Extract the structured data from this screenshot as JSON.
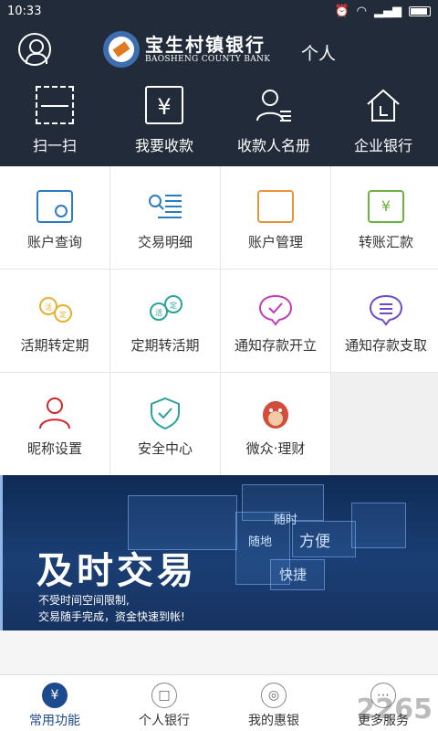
{
  "status": {
    "time": "10:33"
  },
  "header": {
    "bank_name_cn": "宝生村镇银行",
    "bank_name_en": "BAOSHENG COUNTY BANK",
    "mode": "个人"
  },
  "quick": [
    {
      "label": "扫一扫",
      "icon": "scan-icon"
    },
    {
      "label": "我要收款",
      "icon": "receive-money-icon"
    },
    {
      "label": "收款人名册",
      "icon": "payee-list-icon"
    },
    {
      "label": "企业银行",
      "icon": "enterprise-bank-icon"
    }
  ],
  "grid": [
    {
      "label": "账户查询",
      "icon": "account-query-icon"
    },
    {
      "label": "交易明细",
      "icon": "transaction-detail-icon"
    },
    {
      "label": "账户管理",
      "icon": "account-manage-icon"
    },
    {
      "label": "转账汇款",
      "icon": "transfer-icon"
    },
    {
      "label": "活期转定期",
      "icon": "demand-to-fixed-icon"
    },
    {
      "label": "定期转活期",
      "icon": "fixed-to-demand-icon"
    },
    {
      "label": "通知存款开立",
      "icon": "notice-deposit-open-icon"
    },
    {
      "label": "通知存款支取",
      "icon": "notice-deposit-withdraw-icon"
    },
    {
      "label": "昵称设置",
      "icon": "nickname-icon"
    },
    {
      "label": "安全中心",
      "icon": "security-shield-icon"
    },
    {
      "label": "微众·理财",
      "icon": "wealth-mascot-icon"
    }
  ],
  "banner": {
    "title": "及时交易",
    "line1": "不受时间空间限制,",
    "line2": "交易随手完成，资金快速到帐!",
    "tags": [
      "随时",
      "随地",
      "方便",
      "快捷"
    ]
  },
  "nav": [
    {
      "label": "常用功能",
      "glyph": "¥",
      "active": true
    },
    {
      "label": "个人银行",
      "glyph": "□",
      "active": false
    },
    {
      "label": "我的惠银",
      "glyph": "◎",
      "active": false
    },
    {
      "label": "更多服务",
      "glyph": "⋯",
      "active": false
    }
  ],
  "watermark": "2265"
}
